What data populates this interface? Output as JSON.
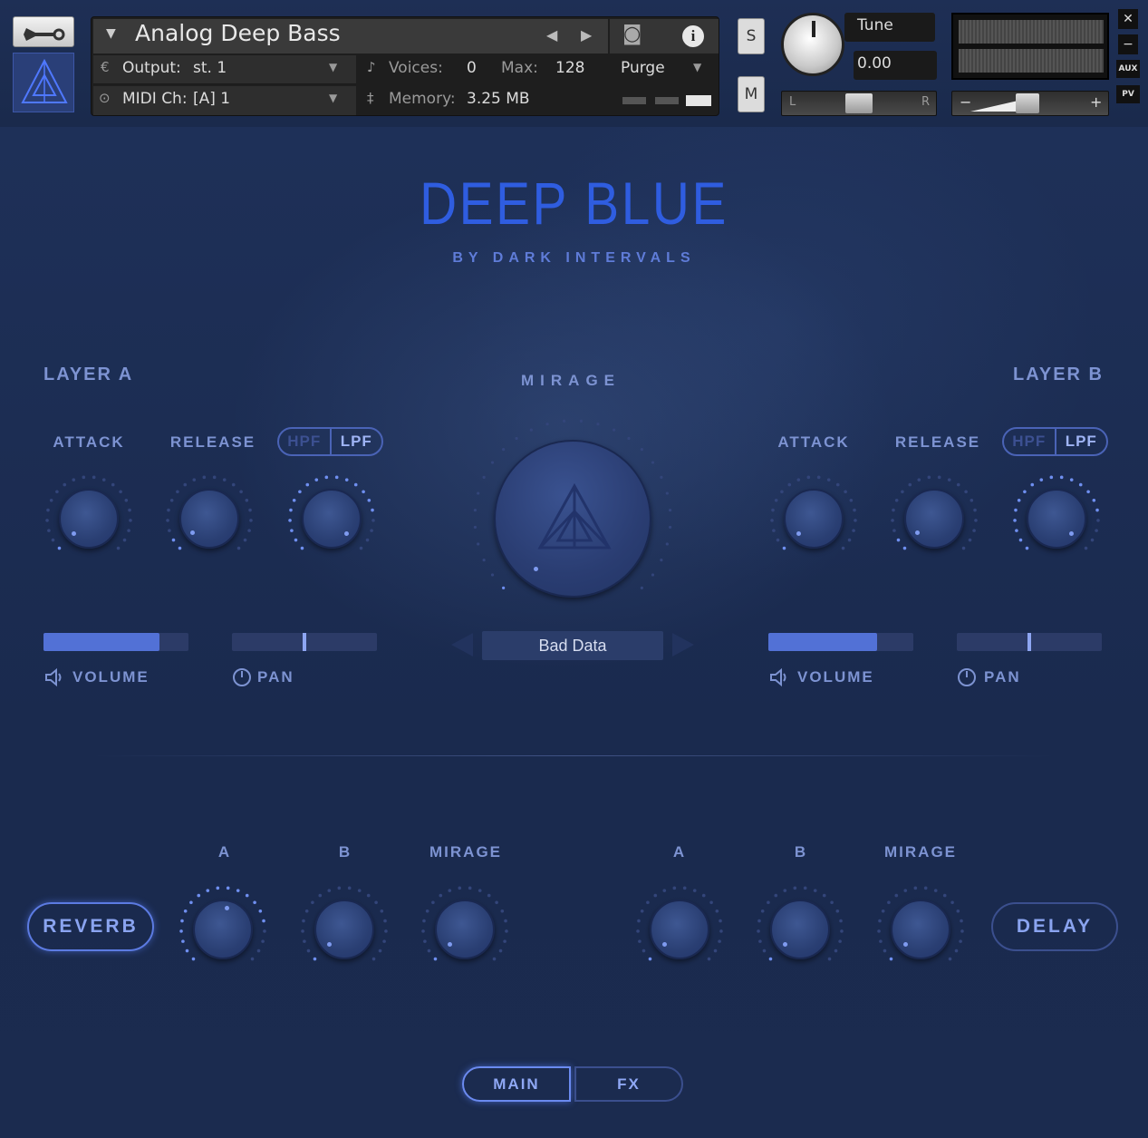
{
  "host": {
    "instrument_name": "Analog Deep Bass",
    "output_label": "Output:",
    "output_value": "st. 1",
    "voices_label": "Voices:",
    "voices_value": "0",
    "max_label": "Max:",
    "max_value": "128",
    "midi_label": "MIDI Ch:",
    "midi_value": "[A]  1",
    "memory_label": "Memory:",
    "memory_value": "3.25 MB",
    "purge_label": "Purge",
    "solo_label": "S",
    "mute_label": "M",
    "tune_label": "Tune",
    "tune_value": "0.00",
    "pan_l": "L",
    "pan_r": "R",
    "vol_minus": "−",
    "vol_plus": "+",
    "close_label": "✕",
    "minimize_label": "−",
    "aux_label": "AUX",
    "pv_label": "PV"
  },
  "title": {
    "main": "DEEP BLUE",
    "sub": "BY DARK INTERVALS"
  },
  "layer_a": {
    "title": "LAYER A",
    "attack": "ATTACK",
    "release": "RELEASE",
    "hpf": "HPF",
    "lpf": "LPF",
    "volume": "VOLUME",
    "pan": "PAN",
    "volume_level": 0.8,
    "pan_position": 0.5
  },
  "layer_b": {
    "title": "LAYER B",
    "attack": "ATTACK",
    "release": "RELEASE",
    "hpf": "HPF",
    "lpf": "LPF",
    "volume": "VOLUME",
    "pan": "PAN",
    "volume_level": 0.75,
    "pan_position": 0.5
  },
  "mirage": {
    "label": "MIRAGE",
    "preset": "Bad Data"
  },
  "fx": {
    "reverb_button": "REVERB",
    "delay_button": "DELAY",
    "reverb_knobs": [
      "A",
      "B",
      "MIRAGE"
    ],
    "delay_knobs": [
      "A",
      "B",
      "MIRAGE"
    ]
  },
  "tabs": {
    "main": "MAIN",
    "fx": "FX",
    "active": "MAIN"
  },
  "colors": {
    "accent": "#2f5de0",
    "label": "#7d93d2",
    "panel": "#1b2b4e"
  }
}
